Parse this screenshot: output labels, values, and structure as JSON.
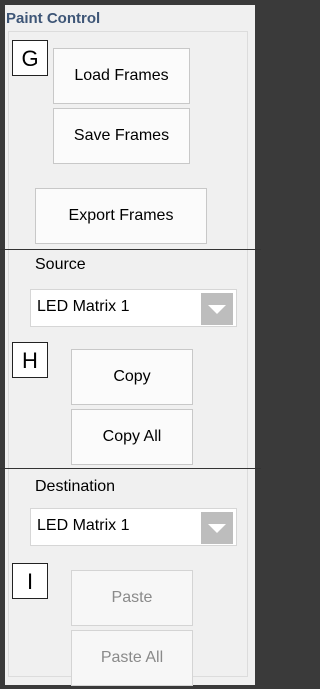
{
  "panel": {
    "title": "Paint Control",
    "sections": {
      "frames": {
        "marker": "G",
        "load_label": "Load Frames",
        "save_label": "Save Frames",
        "export_label": "Export Frames"
      },
      "source": {
        "label": "Source",
        "selected": "LED Matrix 1",
        "marker": "H",
        "copy_label": "Copy",
        "copy_all_label": "Copy All"
      },
      "destination": {
        "label": "Destination",
        "selected": "LED Matrix 1",
        "marker": "I",
        "paste_label": "Paste",
        "paste_all_label": "Paste All"
      }
    }
  },
  "colors": {
    "title": "#3e5677",
    "background": "#f0f0f0",
    "disabled_text": "#8a8a8a",
    "dropdown_arrow": "#bdbdbd"
  }
}
